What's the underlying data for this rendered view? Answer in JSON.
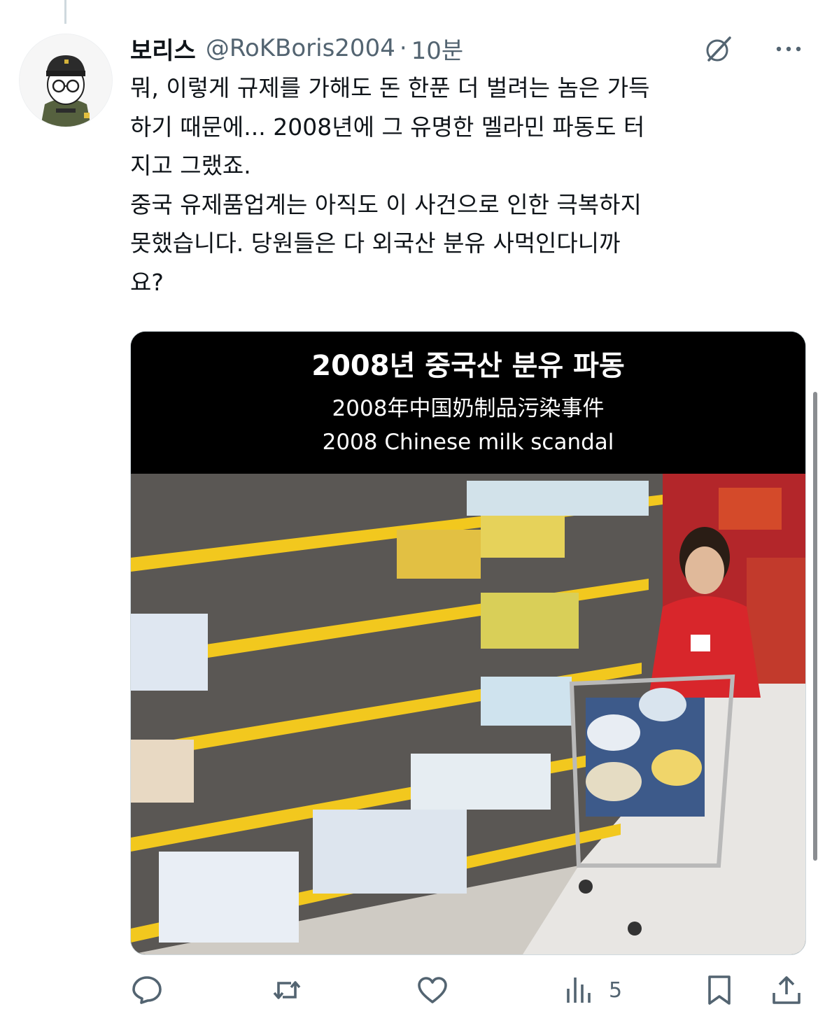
{
  "tweet": {
    "display_name": "보리스",
    "handle": "@RoKBoris2004",
    "separator": "·",
    "time": "10분",
    "text": "뭐, 이렇게 규제를 가해도 돈 한푼 더 벌려는 놈은 가득\n하기 때문에... 2008년에 그 유명한 멜라민 파동도 터\n지고 그랬죠.\n중국 유제품업계는 아직도 이 사건으로 인한 극복하지\n못했습니다. 당원들은 다 외국산 분유 사먹인다니까\n요?"
  },
  "media": {
    "title": "2008년 중국산 분유 파동",
    "title_cn": "2008年中国奶制品污染事件",
    "title_en": "2008 Chinese milk scandal"
  },
  "actions": {
    "reply_icon": "reply-icon",
    "retweet_icon": "retweet-icon",
    "like_icon": "heart-icon",
    "views_icon": "views-chart-icon",
    "views_count": "5",
    "bookmark_icon": "bookmark-icon",
    "share_icon": "share-icon"
  },
  "colors": {
    "text": "#0f1419",
    "secondary": "#536471",
    "shelf_yellow": "#f2c81e",
    "uniform_red": "#d8262b"
  }
}
